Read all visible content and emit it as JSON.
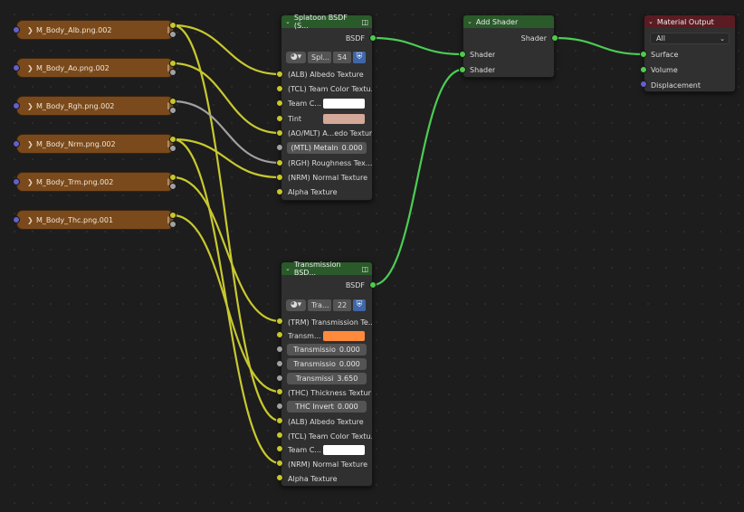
{
  "colors": {
    "image_frame": "#7a4a1c",
    "shader_header": "#2a5a2a",
    "output_header": "#5a1c22",
    "socket_color": "#c7c729",
    "socket_shader": "#4ecb4e",
    "socket_float": "#a1a1a1",
    "socket_vector": "#6161d0",
    "wire_color": "#c8c830",
    "wire_shader": "#4ccc55",
    "wire_float": "#a0a0a0"
  },
  "icons": {
    "collapse": "chevron-down-icon",
    "expand": "chevron-right-icon",
    "node_group": "node-group-icon",
    "shading_sphere": "sphere-icon",
    "fake_user": "shield-icon"
  },
  "image_nodes": [
    {
      "label": "M_Body_Alb.png.002"
    },
    {
      "label": "M_Body_Ao.png.002"
    },
    {
      "label": "M_Body_Rgh.png.002"
    },
    {
      "label": "M_Body_Nrm.png.002"
    },
    {
      "label": "M_Body_Trm.png.002"
    },
    {
      "label": "M_Body_Thc.png.001"
    }
  ],
  "splatoon": {
    "title": "Splatoon BSDF (S...",
    "output": "BSDF",
    "selector_name": "Spl...",
    "selector_users": "54",
    "inputs": {
      "albedo": "(ALB) Albedo Texture",
      "team_color": "(TCL) Team Color Textu...",
      "team_c": "Team C...",
      "tint": "Tint",
      "ao": "(AO/MLT) A...edo Textur",
      "metal_label": "(MTL) Metaln",
      "metal_value": "0.000",
      "roughness": "(RGH) Roughness Tex...",
      "normal": "(NRM) Normal Texture",
      "alpha": "Alpha Texture"
    },
    "team_color_swatch": "#ffffff",
    "tint_swatch": "#d4a99a"
  },
  "transmission": {
    "title": "Transmission BSD...",
    "output": "BSDF",
    "selector_name": "Tra...",
    "selector_users": "22",
    "inputs": {
      "trm": "(TRM) Transmission Te...",
      "transm": "Transm...",
      "f1_label": "Transmissio",
      "f1_value": "0.000",
      "f2_label": "Transmissio",
      "f2_value": "0.000",
      "f3_label": "Transmissi",
      "f3_value": "3.650",
      "thc": "(THC) Thickness Textur",
      "thc_invert_label": "THC Invert",
      "thc_invert_value": "0.000",
      "albedo": "(ALB) Albedo Texture",
      "team_color": "(TCL) Team Color Textu...",
      "team_c": "Team C...",
      "normal": "(NRM) Normal Texture",
      "alpha": "Alpha Texture"
    },
    "transm_swatch": "#ff8a3c",
    "team_color_swatch": "#ffffff"
  },
  "add_shader": {
    "title": "Add Shader",
    "output": "Shader",
    "input1": "Shader",
    "input2": "Shader"
  },
  "material_output": {
    "title": "Material Output",
    "target": "All",
    "surface": "Surface",
    "volume": "Volume",
    "displacement": "Displacement"
  }
}
